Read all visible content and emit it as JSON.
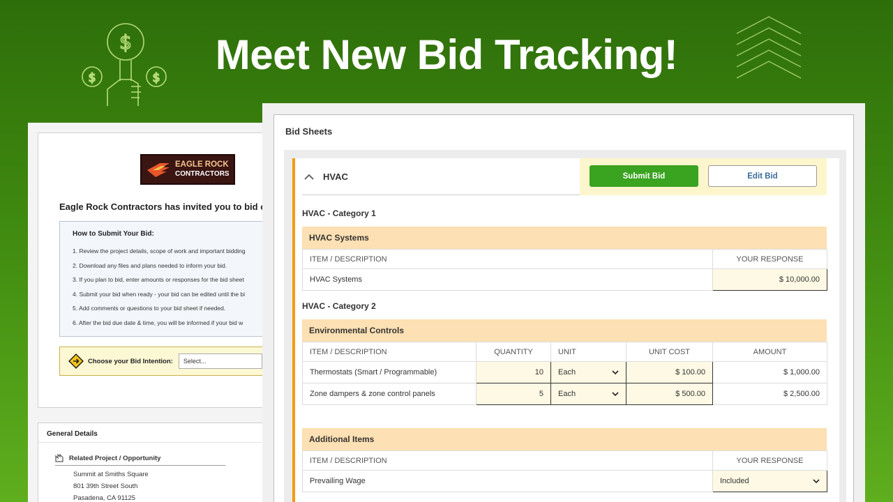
{
  "headline": "Meet New Bid Tracking!",
  "colors": {
    "brand_green": "#3aa320",
    "accent_orange": "#f39c12",
    "section_peach": "#fde0b3",
    "input_cream": "#fdf9e4"
  },
  "icons": [
    "money-hand-icon",
    "chevrons-up-icon",
    "eagle-logo-icon",
    "chevron-up-icon",
    "chevron-down-icon",
    "directions-sign-icon",
    "project-icon"
  ],
  "invitation": {
    "logo_line1": "EAGLE ROCK",
    "logo_line2": "CONTRACTORS",
    "title": "Eagle Rock Contractors has invited you to bid on",
    "howto_title": "How to Submit Your Bid:",
    "steps": [
      "1. Review the project details, scope of work and important bidding",
      "2. Download any files and plans needed to inform your bid.",
      "3. If you plan to bid, enter amounts or responses for the bid sheet",
      "4. Submit your bid when ready - your bid can be edited until the bi",
      "5. Add comments or questions to your bid sheet if needed.",
      "6. After the bid due date & time, you will be informed if your bid w"
    ],
    "intention_label": "Choose your Bid Intention:",
    "intention_value": "Select..."
  },
  "general": {
    "title": "General Details",
    "related_label": "Related Project / Opportunity",
    "address": [
      "Summit at Smiths Square",
      "801 39th Street South",
      "Pasadena, CA 91125"
    ]
  },
  "bid_sheets": {
    "title": "Bid Sheets",
    "sheet_title": "HVAC",
    "submit_label": "Submit Bid",
    "edit_label": "Edit Bid",
    "category1": {
      "title": "HVAC - Category 1",
      "section": "HVAC Systems",
      "col_item": "ITEM / DESCRIPTION",
      "col_response": "YOUR RESPONSE",
      "rows": [
        {
          "item": "HVAC Systems",
          "response": "$ 10,000.00"
        }
      ]
    },
    "category2": {
      "title": "HVAC - Category 2",
      "section": "Environmental Controls",
      "cols": [
        "ITEM / DESCRIPTION",
        "QUANTITY",
        "UNIT",
        "UNIT COST",
        "AMOUNT"
      ],
      "rows": [
        {
          "item": "Thermostats (Smart / Programmable)",
          "qty": "10",
          "unit": "Each",
          "unit_cost": "$ 100.00",
          "amount": "$ 1,000.00"
        },
        {
          "item": "Zone dampers & zone control panels",
          "qty": "5",
          "unit": "Each",
          "unit_cost": "$ 500.00",
          "amount": "$ 2,500.00"
        }
      ]
    },
    "additional": {
      "section": "Additional Items",
      "col_item": "ITEM / DESCRIPTION",
      "col_response": "YOUR RESPONSE",
      "rows": [
        {
          "item": "Prevailing Wage",
          "response": "Included"
        }
      ]
    }
  }
}
